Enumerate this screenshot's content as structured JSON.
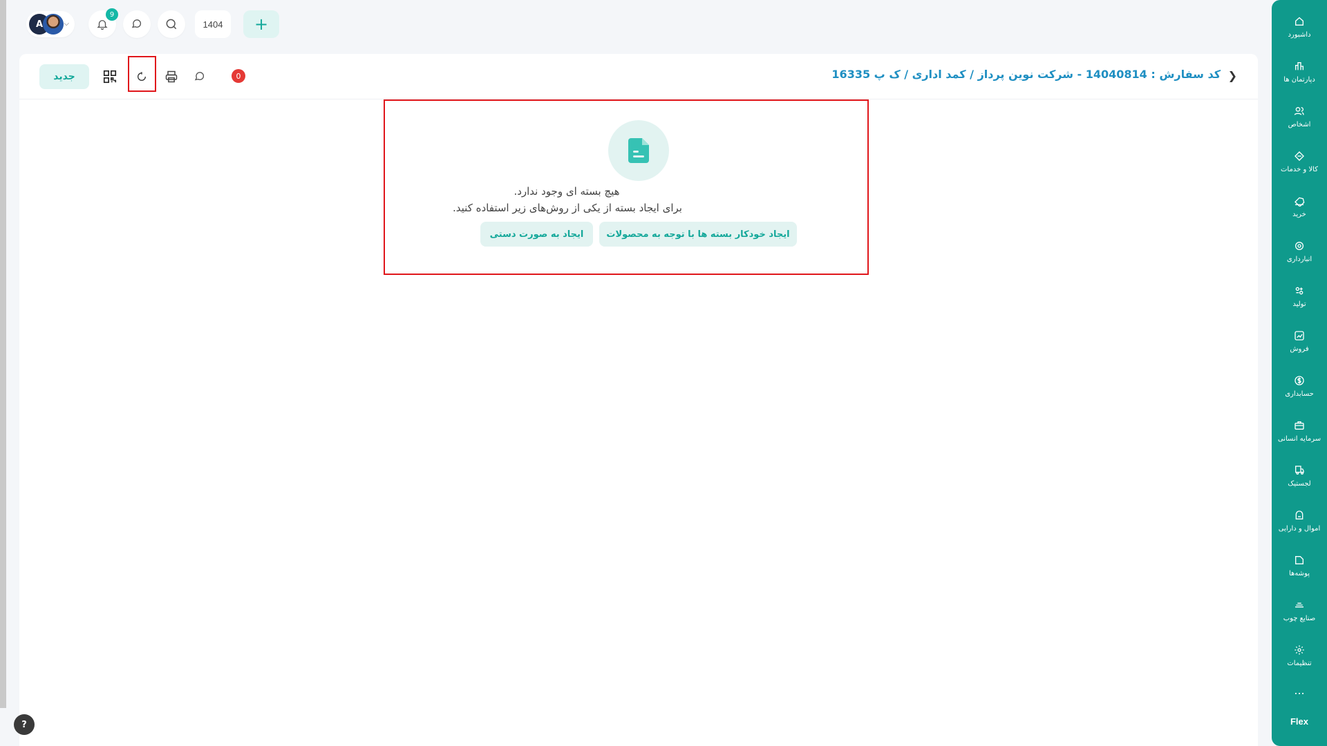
{
  "topbar": {
    "avatar_initial": "A",
    "notification_count": "9",
    "year": "1404",
    "add_symbol": "+"
  },
  "header": {
    "breadcrumb": "کد سفارش : 14040814 - شرکت نوین پرداز / کمد اداری / ک پ 16335",
    "new_button": "جدید",
    "count_badge": "0"
  },
  "empty_state": {
    "title": "هیچ بسته ای وجود ندارد.",
    "subtitle": "برای ایجاد بسته از یکی از روش‌های زیر استفاده کنید.",
    "auto_button": "ایجاد خودکار بسته ها با توجه به محصولات",
    "manual_button": "ایجاد به صورت دستی"
  },
  "sidebar": {
    "items": [
      {
        "label": "داشبورد",
        "icon": "home-icon"
      },
      {
        "label": "دپارتمان ها",
        "icon": "building-icon"
      },
      {
        "label": "اشخاص",
        "icon": "users-icon"
      },
      {
        "label": "کالا و خدمات",
        "icon": "box-icon"
      },
      {
        "label": "خرید",
        "icon": "tag-icon"
      },
      {
        "label": "انبارداری",
        "icon": "warehouse-icon"
      },
      {
        "label": "تولید",
        "icon": "factory-icon"
      },
      {
        "label": "فروش",
        "icon": "chart-icon"
      },
      {
        "label": "حسابداری",
        "icon": "dollar-icon"
      },
      {
        "label": "سرمایه انسانی",
        "icon": "briefcase-icon"
      },
      {
        "label": "لجستیک",
        "icon": "truck-icon"
      },
      {
        "label": "اموال و دارایی",
        "icon": "asset-icon"
      },
      {
        "label": "پوشه‌ها",
        "icon": "folder-icon"
      },
      {
        "label": "صنایع چوب",
        "icon": "wood-icon"
      },
      {
        "label": "تنظیمات",
        "icon": "gear-icon"
      }
    ],
    "more": "...",
    "logo": "Flex"
  },
  "help": "?",
  "colors": {
    "accent": "#0f9a8c",
    "accent_light": "#dff4f2",
    "link": "#1f8fc2",
    "highlight": "#e0161b",
    "badge_red": "#e53935"
  }
}
